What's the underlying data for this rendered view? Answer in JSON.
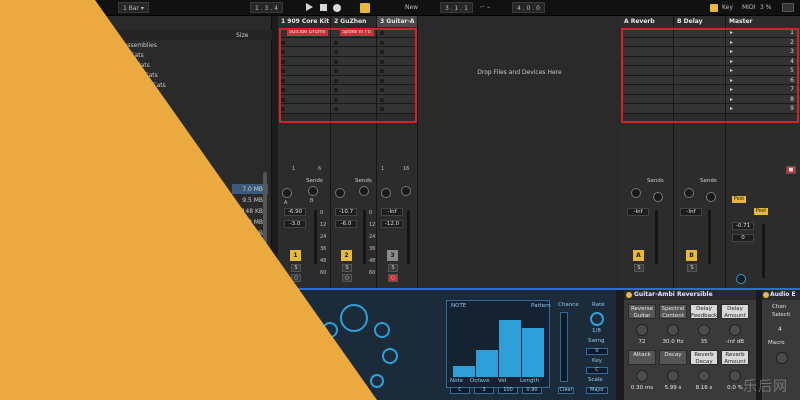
{
  "topbar": {
    "bar_value": "1 Bar",
    "position": "1 .  3 .  4",
    "new_label": "New",
    "loop_start": "3 .  1 .  1",
    "loop_length": "4 .  0 .  0",
    "key_label": "Key",
    "midi_label": "MIDI",
    "cpu": "3 %"
  },
  "browser": {
    "size_header": "Size",
    "items": [
      "o assemblies",
      "r Cats",
      "r Cats",
      "r Cats",
      "r Cats"
    ],
    "sizes": [
      "7.0 MB",
      "9.5 MB",
      "148 KB",
      "6.0 MB",
      "5.0 MB"
    ]
  },
  "tracks": [
    {
      "name": "1 909 Core Kit",
      "clip": "Suicide Drums",
      "num": "1",
      "vol": "-6.90",
      "pan": "-3.0",
      "color": "#e8b93a"
    },
    {
      "name": "2 GuZhen",
      "clip": "Spoke In Fo",
      "num": "2",
      "vol": "-10.7",
      "pan": "-6.0",
      "color": "#e8b93a"
    },
    {
      "name": "3 Guitar-A",
      "clip": "",
      "num": "3",
      "vol": "-Inf",
      "pan": "-12.0",
      "color": "#8a8a8a"
    }
  ],
  "track_clip_count": [
    "1",
    "6",
    "1",
    "16"
  ],
  "drop_text": "Drop Files and Devices Here",
  "returns": [
    {
      "name": "A Reverb",
      "num": "A",
      "vol": "-Inf"
    },
    {
      "name": "B Delay",
      "num": "B",
      "vol": "-Inf"
    }
  ],
  "master": {
    "name": "Master",
    "vol": "-0.71",
    "pan": "0",
    "post": "Post"
  },
  "scenes": [
    "1",
    "2",
    "3",
    "4",
    "5",
    "6",
    "7",
    "8",
    "9"
  ],
  "sends_label": "Sends",
  "send_a": "A",
  "send_b": "B",
  "meter_ticks": [
    "0",
    "12",
    "24",
    "36",
    "48",
    "60"
  ],
  "arp": {
    "note_label": "NOTE",
    "pattern_label": "Pattern",
    "chance_label": "Chance",
    "rate_label": "Rate",
    "rate_val": "1/8",
    "swing_label": "Swing",
    "key_label": "Key",
    "scale_label": "Scale",
    "scale_val": "Major",
    "key_val": "C",
    "cols": [
      "Note",
      "Octave",
      "Vel",
      "Length"
    ],
    "col_vals": [
      "C",
      "3",
      "100",
      "0.90"
    ],
    "bars": [
      0.18,
      0.45,
      0.95,
      0.82
    ],
    "clear_label": "Clear"
  },
  "rev": {
    "title": "Guitar-Ambi Reversible",
    "buttons": [
      "Reverse Guitar",
      "Spectral Content",
      "Delay Feedback",
      "Delay Amount"
    ],
    "values": [
      "72",
      "30.0 Hz",
      "35",
      "-inf dB"
    ],
    "buttons2": [
      "Attack",
      "Decay",
      "Reverb Decay",
      "Reverb Amount"
    ],
    "values2": [
      "0.30 ms",
      "5.99 s",
      "8.16 s",
      "0.0 %"
    ]
  },
  "audio": {
    "title": "Audio E",
    "chan": "Chan",
    "select": "Selecti",
    "macro": "Macro",
    "val": "4"
  },
  "watermark": "乐后网"
}
